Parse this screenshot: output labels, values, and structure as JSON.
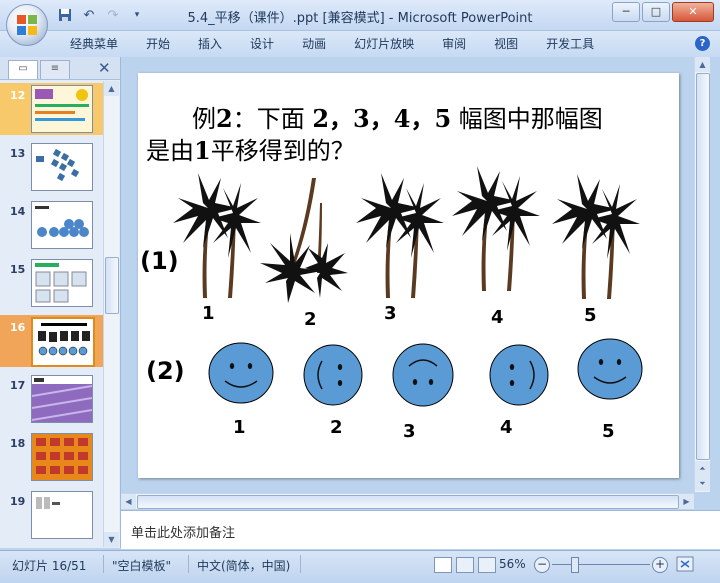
{
  "window": {
    "title": "5.4_平移（课件）.ppt [兼容模式] - Microsoft PowerPoint",
    "controls": {
      "minimize": "─",
      "restore": "□",
      "close": "✕"
    }
  },
  "quick_access": {
    "save_icon": "save-icon",
    "undo_icon": "undo-icon",
    "redo_icon": "redo-icon",
    "customize_icon": "customize-icon"
  },
  "ribbon": {
    "tabs": [
      "经典菜单",
      "开始",
      "插入",
      "设计",
      "动画",
      "幻灯片放映",
      "审阅",
      "视图",
      "开发工具"
    ],
    "help_label": "?"
  },
  "slide_panel": {
    "tab_slides": "▭",
    "tab_outline": "≡",
    "close": "✕",
    "thumbnails": [
      {
        "num": "12",
        "selected": false
      },
      {
        "num": "13",
        "selected": false
      },
      {
        "num": "14",
        "selected": false
      },
      {
        "num": "15",
        "selected": false
      },
      {
        "num": "16",
        "selected": true
      },
      {
        "num": "17",
        "selected": false
      },
      {
        "num": "18",
        "selected": false
      },
      {
        "num": "19",
        "selected": false
      }
    ]
  },
  "slide": {
    "question_prefix": "例",
    "question_bold_num": "2",
    "question_rest": "：下面",
    "question_nums": "2，3，4，5",
    "question_tail": "幅图中那幅图",
    "question_line2_pre": "是由",
    "question_line2_num": "1",
    "question_line2_post": "平移得到的？",
    "row1_label": "(1)",
    "row2_label": "(2)",
    "tree_numbers": [
      "1",
      "2",
      "3",
      "4",
      "5"
    ],
    "face_numbers": [
      "1",
      "2",
      "3",
      "4",
      "5"
    ],
    "face_color": "#5b9bd5"
  },
  "notes": {
    "placeholder": "单击此处添加备注"
  },
  "status": {
    "slide_info": "幻灯片 16/51",
    "template": "\"空白模板\"",
    "language": "中文(简体，中国)",
    "zoom": "56%"
  }
}
